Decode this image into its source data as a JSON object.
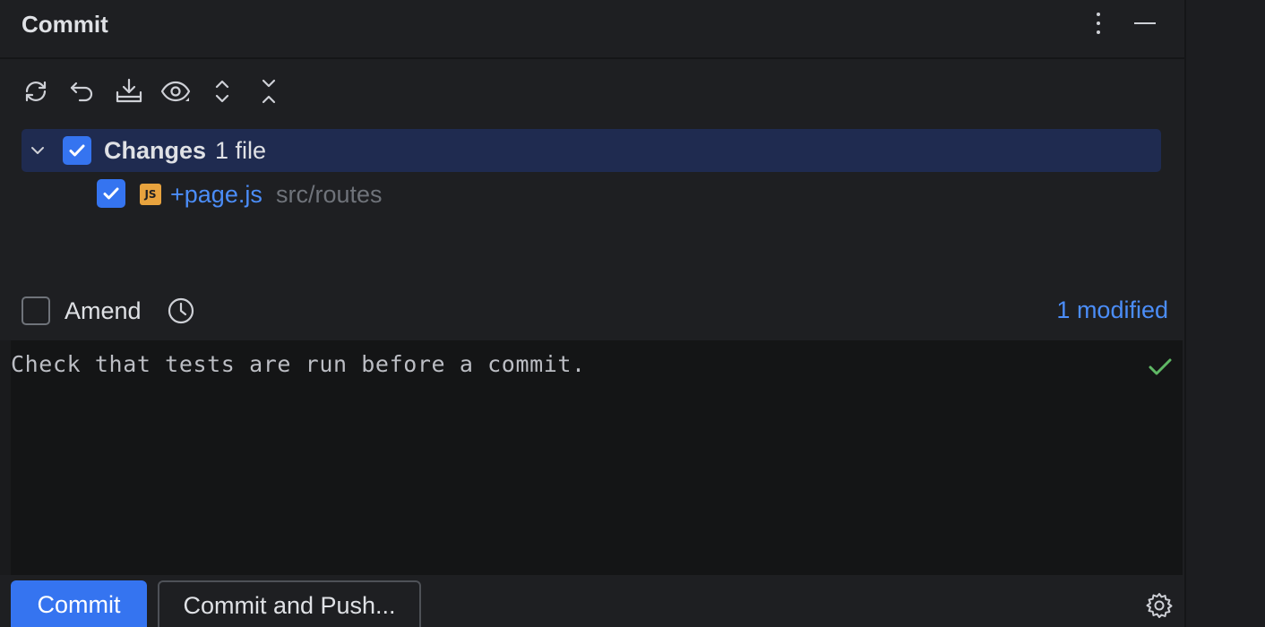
{
  "panel": {
    "title": "Commit"
  },
  "header_actions": {
    "more_icon": "vertical-dots-icon",
    "minimize_icon": "minimize-icon"
  },
  "toolbar": {
    "items": [
      {
        "icon": "refresh-icon"
      },
      {
        "icon": "rollback-icon"
      },
      {
        "icon": "shelve-download-icon"
      },
      {
        "icon": "eye-icon"
      },
      {
        "icon": "expand-all-icon"
      },
      {
        "icon": "collapse-all-icon"
      }
    ]
  },
  "changes": {
    "group_label": "Changes",
    "group_count": "1 file",
    "checked": true,
    "files": [
      {
        "icon_text": "JS",
        "name": "+page.js",
        "path": "src/routes",
        "checked": true
      }
    ]
  },
  "amend": {
    "label": "Amend",
    "checked": false,
    "modified_link": "1 modified"
  },
  "message": {
    "text": "Check that tests are run before a commit."
  },
  "actions": {
    "commit_label": "Commit",
    "commit_push_label": "Commit and Push..."
  },
  "colors": {
    "accent": "#3574f0",
    "link": "#4b8df8",
    "selection": "#1f2b50",
    "js_badge": "#e8a33e",
    "success": "#5fb865"
  }
}
